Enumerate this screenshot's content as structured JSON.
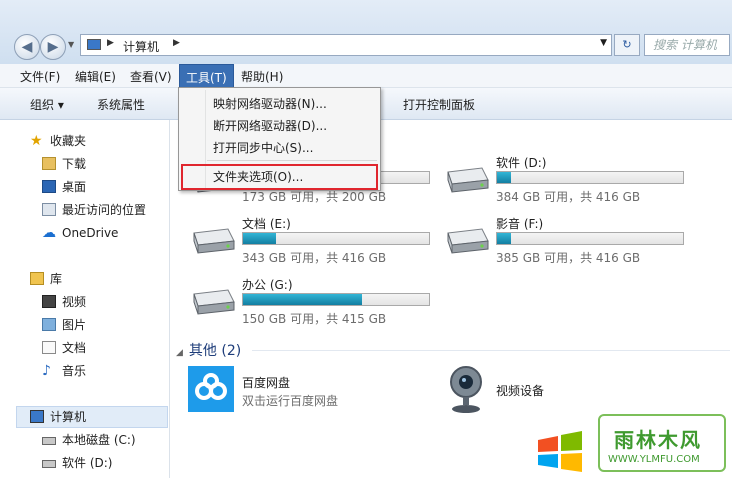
{
  "address": {
    "crumb": "计算机",
    "search_placeholder": "搜索 计算机"
  },
  "menubar": [
    {
      "label": "文件(F)"
    },
    {
      "label": "编辑(E)"
    },
    {
      "label": "查看(V)"
    },
    {
      "label": "工具(T)"
    },
    {
      "label": "帮助(H)"
    }
  ],
  "toolbar": {
    "organize": "组织 ▾",
    "properties": "系统属性",
    "control_panel": "打开控制面板"
  },
  "tools_menu": [
    {
      "label": "映射网络驱动器(N)..."
    },
    {
      "label": "断开网络驱动器(D)..."
    },
    {
      "label": "打开同步中心(S)..."
    },
    {
      "label": "文件夹选项(O)..."
    }
  ],
  "sidebar": {
    "favorites": "收藏夹",
    "fav_items": [
      "下载",
      "桌面",
      "最近访问的位置"
    ],
    "onedrive": "OneDrive",
    "libraries": "库",
    "lib_items": [
      "视频",
      "图片",
      "文档",
      "音乐"
    ],
    "computer": "计算机",
    "drives": [
      "本地磁盘 (C:)",
      "软件 (D:)"
    ]
  },
  "drives": [
    {
      "name": "",
      "free": "173 GB 可用，共 200 GB",
      "used_fraction": 0.135
    },
    {
      "name": "软件 (D:)",
      "free": "384 GB 可用，共 416 GB",
      "used_fraction": 0.077
    },
    {
      "name": "文档 (E:)",
      "free": "343 GB 可用，共 416 GB",
      "used_fraction": 0.175
    },
    {
      "name": "影音 (F:)",
      "free": "385 GB 可用，共 416 GB",
      "used_fraction": 0.075
    },
    {
      "name": "办公 (G:)",
      "free": "150 GB 可用，共 415 GB",
      "used_fraction": 0.64
    }
  ],
  "other_group": {
    "title": "其他 (2)"
  },
  "other_items": [
    {
      "name": "百度网盘",
      "desc": "双击运行百度网盘"
    },
    {
      "name": "视频设备",
      "desc": ""
    }
  ],
  "watermark": {
    "brand": "雨林木风",
    "url": "WWW.YLMFU.COM"
  },
  "colors": {
    "accent": "#3a6fb4",
    "highlight_box": "#e0262e",
    "bar_fill": "#1f95bd"
  }
}
